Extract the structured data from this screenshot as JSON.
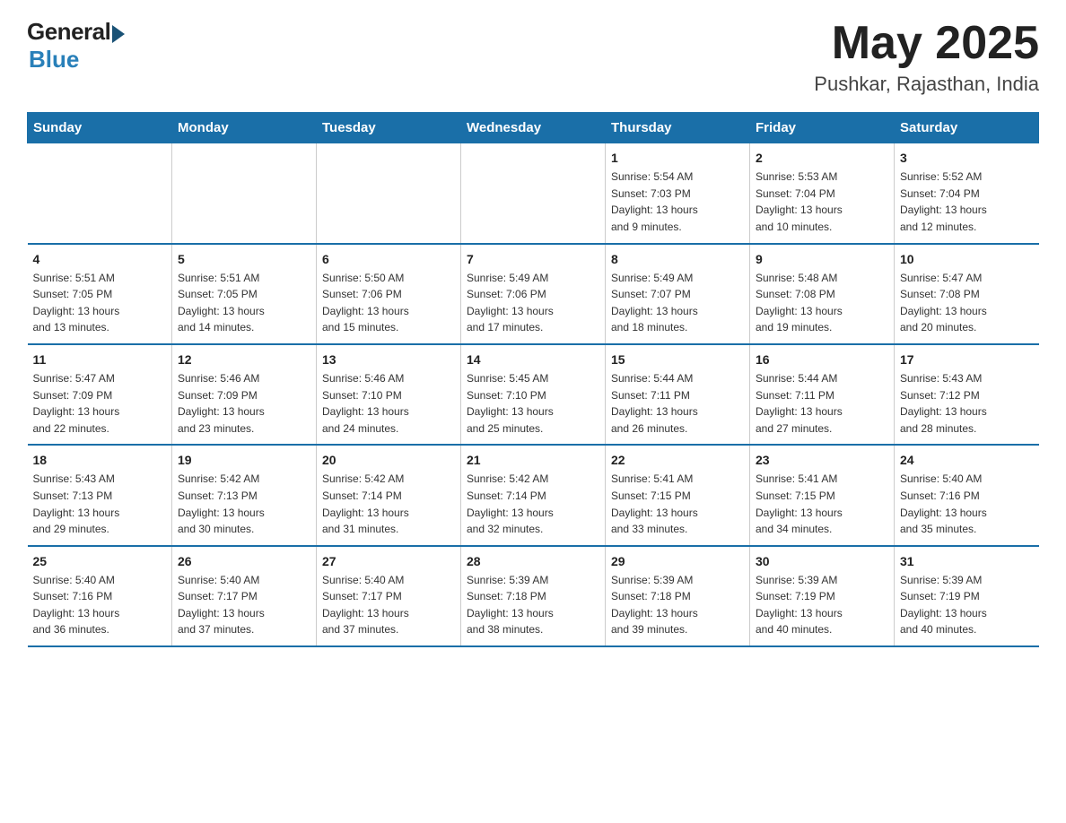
{
  "header": {
    "logo_general": "General",
    "logo_blue": "Blue",
    "month_year": "May 2025",
    "location": "Pushkar, Rajasthan, India"
  },
  "weekdays": [
    "Sunday",
    "Monday",
    "Tuesday",
    "Wednesday",
    "Thursday",
    "Friday",
    "Saturday"
  ],
  "weeks": [
    [
      {
        "day": "",
        "info": ""
      },
      {
        "day": "",
        "info": ""
      },
      {
        "day": "",
        "info": ""
      },
      {
        "day": "",
        "info": ""
      },
      {
        "day": "1",
        "info": "Sunrise: 5:54 AM\nSunset: 7:03 PM\nDaylight: 13 hours\nand 9 minutes."
      },
      {
        "day": "2",
        "info": "Sunrise: 5:53 AM\nSunset: 7:04 PM\nDaylight: 13 hours\nand 10 minutes."
      },
      {
        "day": "3",
        "info": "Sunrise: 5:52 AM\nSunset: 7:04 PM\nDaylight: 13 hours\nand 12 minutes."
      }
    ],
    [
      {
        "day": "4",
        "info": "Sunrise: 5:51 AM\nSunset: 7:05 PM\nDaylight: 13 hours\nand 13 minutes."
      },
      {
        "day": "5",
        "info": "Sunrise: 5:51 AM\nSunset: 7:05 PM\nDaylight: 13 hours\nand 14 minutes."
      },
      {
        "day": "6",
        "info": "Sunrise: 5:50 AM\nSunset: 7:06 PM\nDaylight: 13 hours\nand 15 minutes."
      },
      {
        "day": "7",
        "info": "Sunrise: 5:49 AM\nSunset: 7:06 PM\nDaylight: 13 hours\nand 17 minutes."
      },
      {
        "day": "8",
        "info": "Sunrise: 5:49 AM\nSunset: 7:07 PM\nDaylight: 13 hours\nand 18 minutes."
      },
      {
        "day": "9",
        "info": "Sunrise: 5:48 AM\nSunset: 7:08 PM\nDaylight: 13 hours\nand 19 minutes."
      },
      {
        "day": "10",
        "info": "Sunrise: 5:47 AM\nSunset: 7:08 PM\nDaylight: 13 hours\nand 20 minutes."
      }
    ],
    [
      {
        "day": "11",
        "info": "Sunrise: 5:47 AM\nSunset: 7:09 PM\nDaylight: 13 hours\nand 22 minutes."
      },
      {
        "day": "12",
        "info": "Sunrise: 5:46 AM\nSunset: 7:09 PM\nDaylight: 13 hours\nand 23 minutes."
      },
      {
        "day": "13",
        "info": "Sunrise: 5:46 AM\nSunset: 7:10 PM\nDaylight: 13 hours\nand 24 minutes."
      },
      {
        "day": "14",
        "info": "Sunrise: 5:45 AM\nSunset: 7:10 PM\nDaylight: 13 hours\nand 25 minutes."
      },
      {
        "day": "15",
        "info": "Sunrise: 5:44 AM\nSunset: 7:11 PM\nDaylight: 13 hours\nand 26 minutes."
      },
      {
        "day": "16",
        "info": "Sunrise: 5:44 AM\nSunset: 7:11 PM\nDaylight: 13 hours\nand 27 minutes."
      },
      {
        "day": "17",
        "info": "Sunrise: 5:43 AM\nSunset: 7:12 PM\nDaylight: 13 hours\nand 28 minutes."
      }
    ],
    [
      {
        "day": "18",
        "info": "Sunrise: 5:43 AM\nSunset: 7:13 PM\nDaylight: 13 hours\nand 29 minutes."
      },
      {
        "day": "19",
        "info": "Sunrise: 5:42 AM\nSunset: 7:13 PM\nDaylight: 13 hours\nand 30 minutes."
      },
      {
        "day": "20",
        "info": "Sunrise: 5:42 AM\nSunset: 7:14 PM\nDaylight: 13 hours\nand 31 minutes."
      },
      {
        "day": "21",
        "info": "Sunrise: 5:42 AM\nSunset: 7:14 PM\nDaylight: 13 hours\nand 32 minutes."
      },
      {
        "day": "22",
        "info": "Sunrise: 5:41 AM\nSunset: 7:15 PM\nDaylight: 13 hours\nand 33 minutes."
      },
      {
        "day": "23",
        "info": "Sunrise: 5:41 AM\nSunset: 7:15 PM\nDaylight: 13 hours\nand 34 minutes."
      },
      {
        "day": "24",
        "info": "Sunrise: 5:40 AM\nSunset: 7:16 PM\nDaylight: 13 hours\nand 35 minutes."
      }
    ],
    [
      {
        "day": "25",
        "info": "Sunrise: 5:40 AM\nSunset: 7:16 PM\nDaylight: 13 hours\nand 36 minutes."
      },
      {
        "day": "26",
        "info": "Sunrise: 5:40 AM\nSunset: 7:17 PM\nDaylight: 13 hours\nand 37 minutes."
      },
      {
        "day": "27",
        "info": "Sunrise: 5:40 AM\nSunset: 7:17 PM\nDaylight: 13 hours\nand 37 minutes."
      },
      {
        "day": "28",
        "info": "Sunrise: 5:39 AM\nSunset: 7:18 PM\nDaylight: 13 hours\nand 38 minutes."
      },
      {
        "day": "29",
        "info": "Sunrise: 5:39 AM\nSunset: 7:18 PM\nDaylight: 13 hours\nand 39 minutes."
      },
      {
        "day": "30",
        "info": "Sunrise: 5:39 AM\nSunset: 7:19 PM\nDaylight: 13 hours\nand 40 minutes."
      },
      {
        "day": "31",
        "info": "Sunrise: 5:39 AM\nSunset: 7:19 PM\nDaylight: 13 hours\nand 40 minutes."
      }
    ]
  ]
}
